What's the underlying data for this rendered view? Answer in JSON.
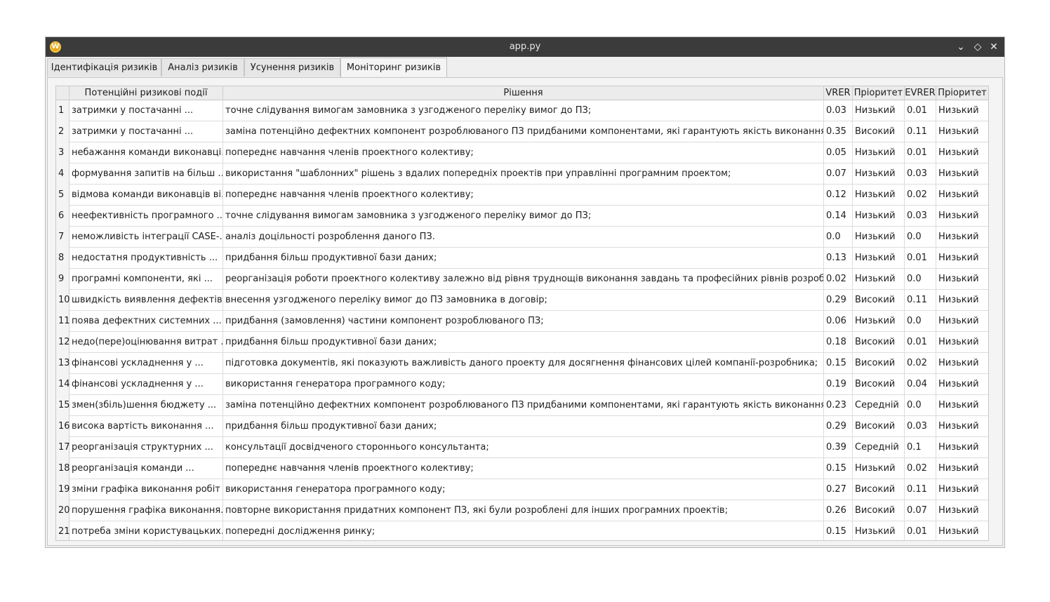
{
  "window": {
    "title": "app.py",
    "app_icon_letter": "W",
    "btn_minimize": "⌄",
    "btn_maximize": "◇",
    "btn_close": "✕"
  },
  "tabs": [
    {
      "label": "Ідентифікація ризиків"
    },
    {
      "label": "Аналіз ризиків"
    },
    {
      "label": "Усунення ризиків"
    },
    {
      "label": "Моніторинг ризиків",
      "active": true
    }
  ],
  "table": {
    "headers": [
      "Потенційні ризикові події",
      "Рішення",
      "VRER",
      "Пріоритет",
      "EVRER",
      "Пріоритет"
    ],
    "rows": [
      [
        "1",
        "затримки у постачанні ...",
        "точне слідування вимогам замовника з узгодженого переліку вимог до ПЗ;",
        "0.03",
        "Низький",
        "0.01",
        "Низький"
      ],
      [
        "2",
        "затримки у постачанні ...",
        "заміна потенційно дефектних компонент розроблюваного ПЗ придбаними компонентами, які гарантують якість виконання роботи;",
        "0.35",
        "Високий",
        "0.11",
        "Низький"
      ],
      [
        "3",
        "небажання команди виконавці...",
        "попереднє навчання членів проектного колективу;",
        "0.05",
        "Низький",
        "0.01",
        "Низький"
      ],
      [
        "4",
        "формування запитів на більш ...",
        "використання \"шаблонних\" рішень з вдалих попередніх проектів при управлінні програмним проектом;",
        "0.07",
        "Низький",
        "0.03",
        "Низький"
      ],
      [
        "5",
        "відмова команди виконавців ві...",
        "попереднє навчання членів проектного колективу;",
        "0.12",
        "Низький",
        "0.02",
        "Низький"
      ],
      [
        "6",
        "неефективність програмного ...",
        "точне слідування вимогам замовника з узгодженого переліку вимог до ПЗ;",
        "0.14",
        "Низький",
        "0.03",
        "Низький"
      ],
      [
        "7",
        "неможливість інтеграції CASE-...",
        "аналіз доцільності розроблення даного ПЗ.",
        "0.0",
        "Низький",
        "0.0",
        "Низький"
      ],
      [
        "8",
        "недостатня продуктивність ...",
        "придбання більш продуктивної бази даних;",
        "0.13",
        "Низький",
        "0.01",
        "Низький"
      ],
      [
        "9",
        "програмні компоненти, які ...",
        "реорганізація роботи проектного колективу залежно від рівня труднощів виконання завдань та професійних рівнів розробників;",
        "0.02",
        "Низький",
        "0.0",
        "Низький"
      ],
      [
        "10",
        "швидкість виявлення дефектів ...",
        "внесення узгодженого переліку вимог до ПЗ замовника в договір;",
        "0.29",
        "Високий",
        "0.11",
        "Низький"
      ],
      [
        "11",
        "поява дефектних системних ...",
        "придбання (замовлення) частини компонент розроблюваного ПЗ;",
        "0.06",
        "Низький",
        "0.0",
        "Низький"
      ],
      [
        "12",
        "недо(пере)оцінювання витрат ...",
        "придбання більш продуктивної бази даних;",
        "0.18",
        "Високий",
        "0.01",
        "Низький"
      ],
      [
        "13",
        "фінансові ускладнення у ...",
        "підготовка документів, які показують важливість даного проекту для досягнення фінансових цілей компанії-розробника;",
        "0.15",
        "Високий",
        "0.02",
        "Низький"
      ],
      [
        "14",
        "фінансові ускладнення у ...",
        "використання генератора програмного коду;",
        "0.19",
        "Високий",
        "0.04",
        "Низький"
      ],
      [
        "15",
        "змен(збіль)шення бюджету ...",
        "заміна потенційно дефектних компонент розроблюваного ПЗ придбаними компонентами, які гарантують якість виконання роботи;",
        "0.23",
        "Середній",
        "0.0",
        "Низький"
      ],
      [
        "16",
        "висока вартість виконання ...",
        "придбання більш продуктивної бази даних;",
        "0.29",
        "Високий",
        "0.03",
        "Низький"
      ],
      [
        "17",
        "реорганізація структурних ...",
        "консультації досвідченого стороннього консультанта;",
        "0.39",
        "Середній",
        "0.1",
        "Низький"
      ],
      [
        "18",
        "реорганізація команди ...",
        "попереднє навчання членів проектного колективу;",
        "0.15",
        "Низький",
        "0.02",
        "Низький"
      ],
      [
        "19",
        "зміни графіка виконання робіт ...",
        "використання генератора програмного коду;",
        "0.27",
        "Високий",
        "0.11",
        "Низький"
      ],
      [
        "20",
        "порушення графіка виконання...",
        "повторне використання придатних компонент ПЗ, які були розроблені для інших програмних проектів;",
        "0.26",
        "Високий",
        "0.07",
        "Низький"
      ],
      [
        "21",
        "потреба зміни користувацьких...",
        "попередні дослідження ринку;",
        "0.15",
        "Низький",
        "0.01",
        "Низький"
      ]
    ]
  },
  "scrollbar": {
    "up_arrow": "▲",
    "down_arrow": "▼"
  }
}
